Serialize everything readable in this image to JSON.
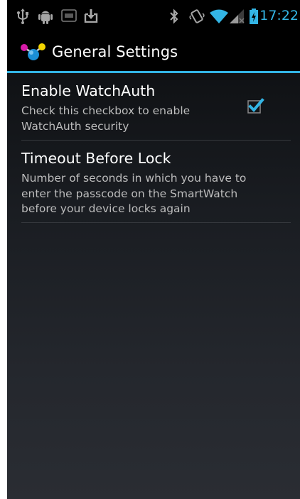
{
  "status_bar": {
    "time": "17:22",
    "icons": [
      "usb-icon",
      "android-debug-icon",
      "sim-icon",
      "download-icon",
      "bluetooth-icon",
      "vibrate-icon",
      "wifi-icon",
      "signal-icon",
      "battery-charging-icon"
    ]
  },
  "action_bar": {
    "title": "General Settings",
    "icon": "app-molecule-icon"
  },
  "preferences": [
    {
      "title": "Enable WatchAuth",
      "summary": "Check this checkbox to enable WatchAuth security",
      "checked": true
    },
    {
      "title": "Timeout Before Lock",
      "summary": "Number of seconds in which you have to enter the passcode on the SmartWatch before your device locks again"
    }
  ],
  "colors": {
    "accent": "#33b5e5",
    "background": "#101215",
    "text_primary": "#ffffff",
    "text_secondary": "#bdbdbd"
  }
}
